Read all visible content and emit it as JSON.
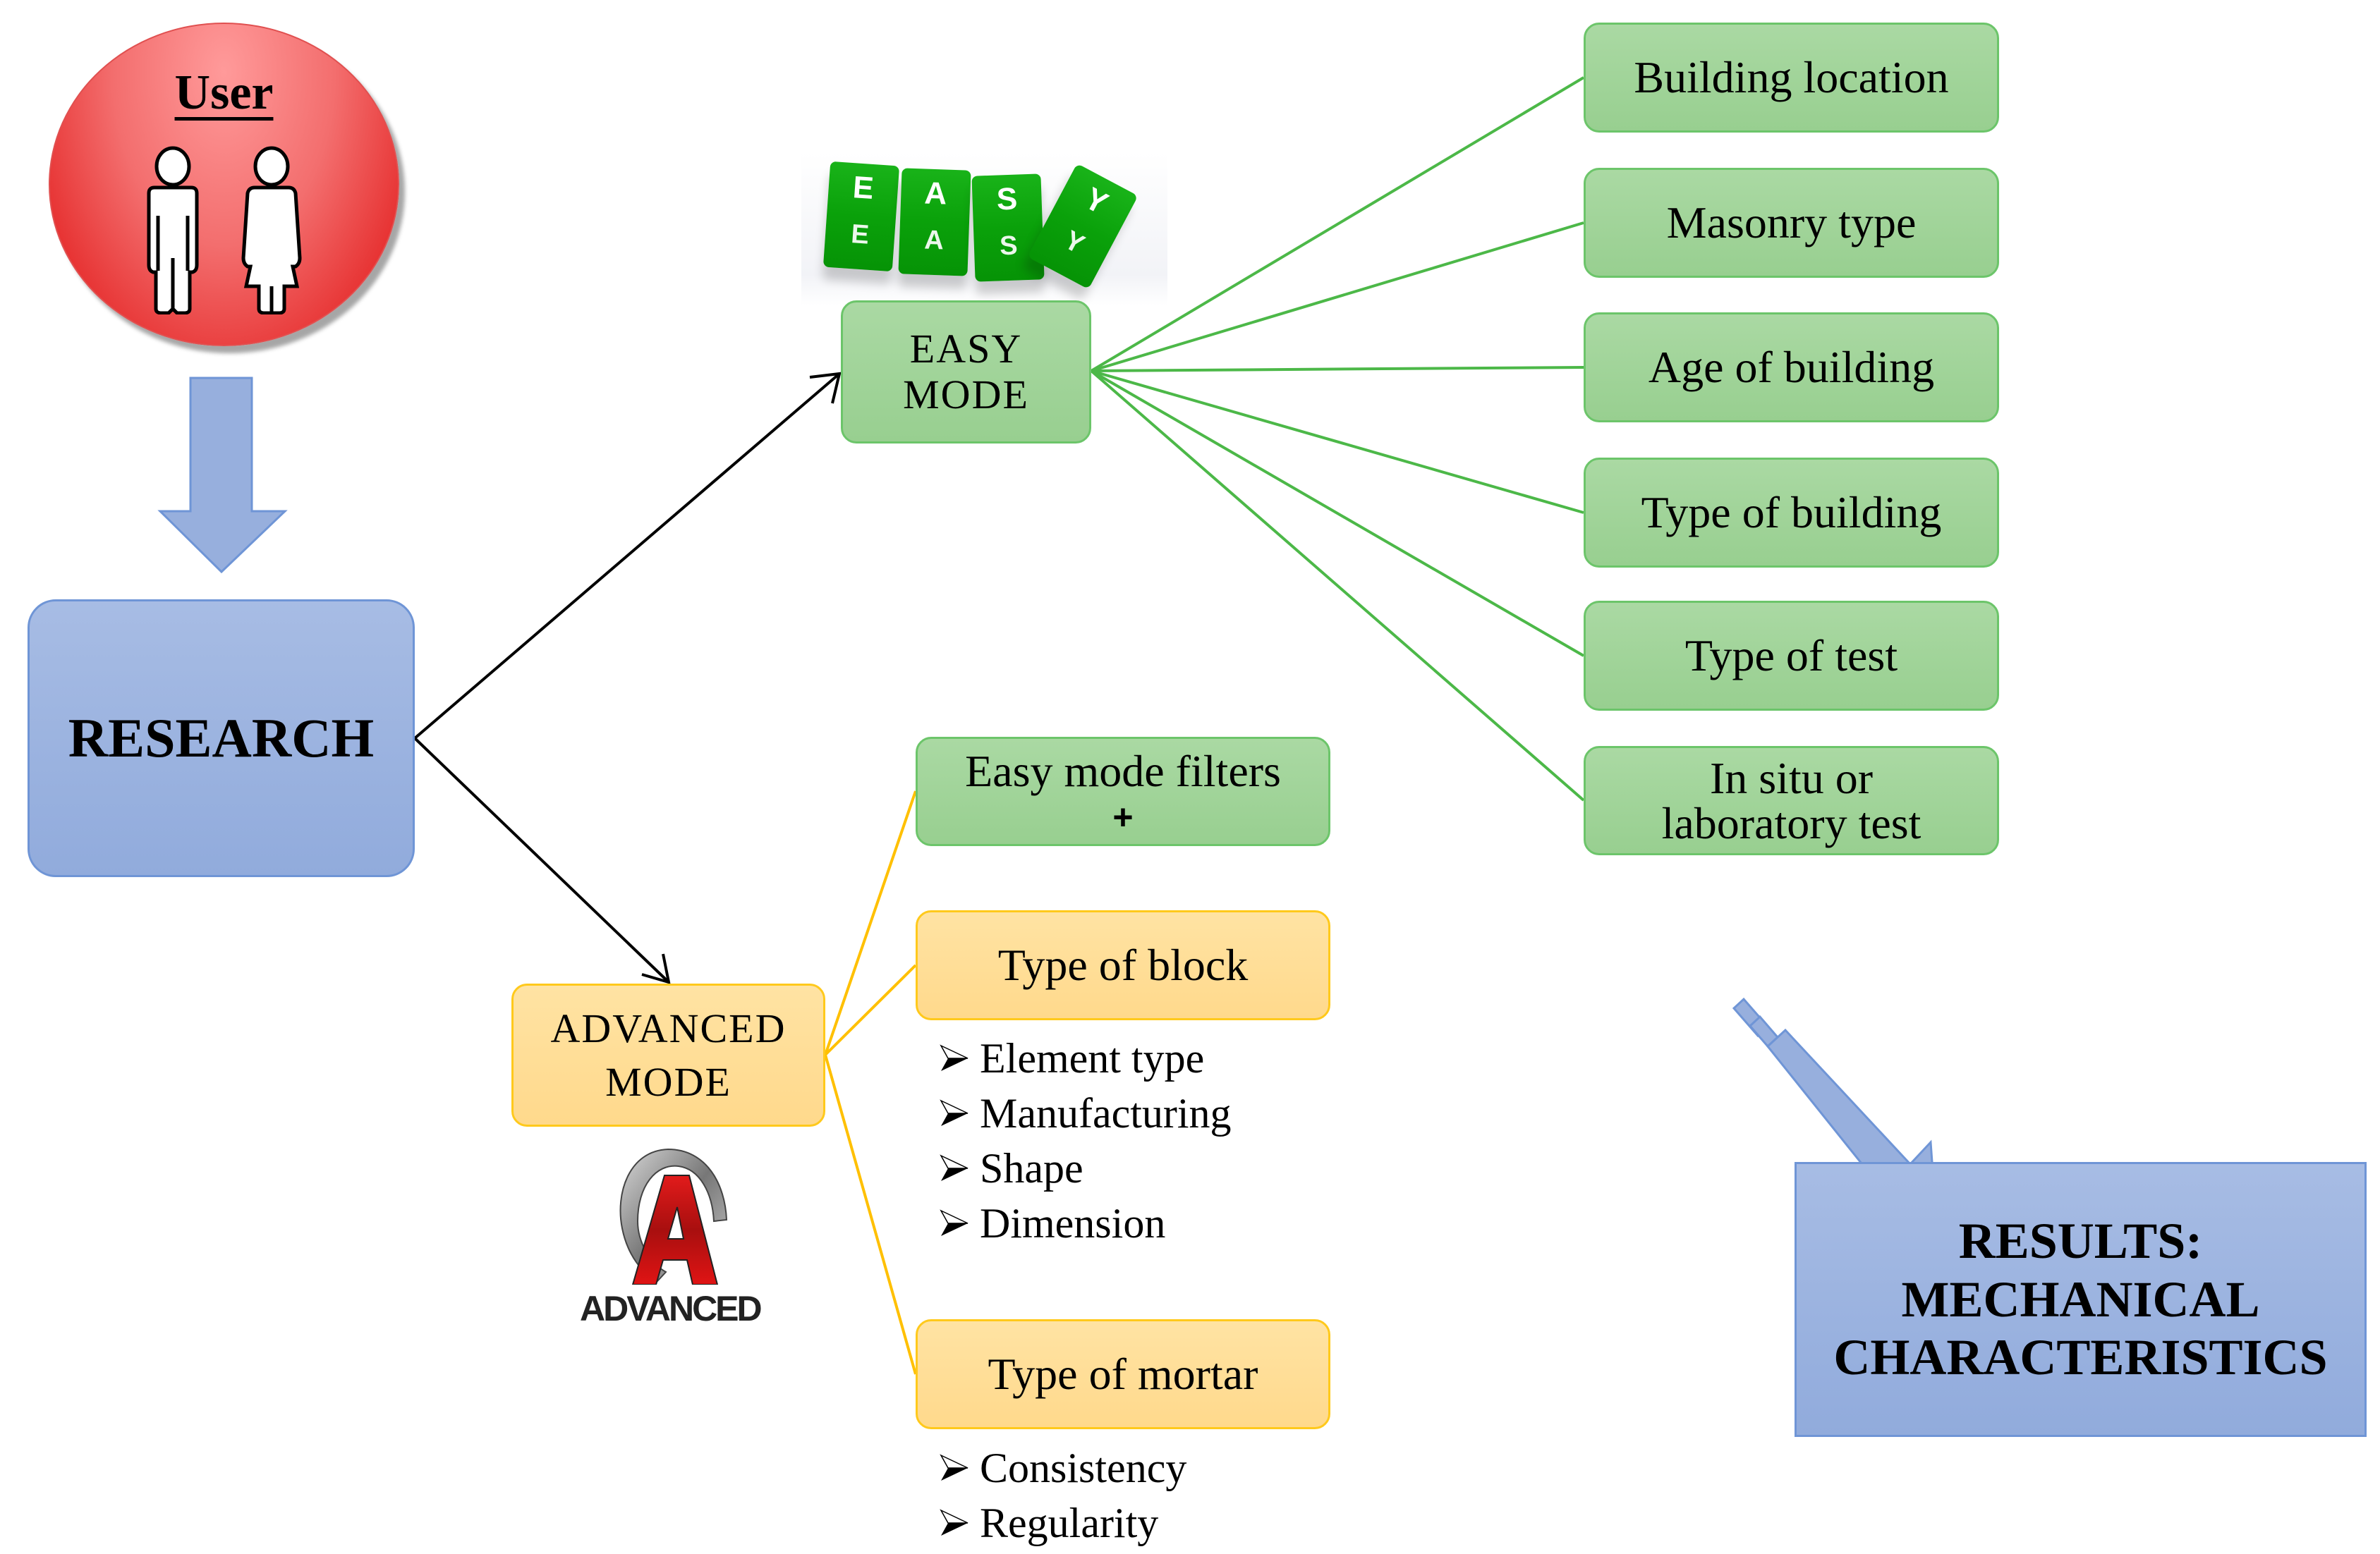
{
  "user": {
    "label": "User",
    "icons": [
      "man-icon",
      "woman-icon"
    ]
  },
  "research": {
    "label": "RESEARCH"
  },
  "easy_mode": {
    "label_line1": "EASY",
    "label_line2": "MODE",
    "cubes": [
      {
        "top": "E",
        "bottom": "E"
      },
      {
        "top": "A",
        "bottom": "A"
      },
      {
        "top": "S",
        "bottom": "S"
      },
      {
        "top": "Y",
        "bottom": "Y"
      }
    ],
    "filters": [
      {
        "lines": [
          "Building location"
        ]
      },
      {
        "lines": [
          "Masonry type"
        ]
      },
      {
        "lines": [
          "Age of building"
        ]
      },
      {
        "lines": [
          "Type of building"
        ]
      },
      {
        "lines": [
          "Type of test"
        ]
      },
      {
        "lines": [
          "In situ or",
          "laboratory test"
        ]
      }
    ]
  },
  "advanced_mode": {
    "label_line1": "ADVANCED",
    "label_line2": "MODE",
    "logo_letter": "A",
    "logo_text": "ADVANCED",
    "easy_filters_box": {
      "line1": "Easy mode filters",
      "line2": "+"
    },
    "type_of_block": {
      "label": "Type of block",
      "items": [
        "Element type",
        "Manufacturing",
        "Shape",
        "Dimension"
      ]
    },
    "type_of_mortar": {
      "label": "Type of mortar",
      "items": [
        "Consistency",
        "Regularity"
      ]
    }
  },
  "results": {
    "line1": "RESULTS:",
    "line2": "MECHANICAL",
    "line3": "CHARACTERISTICS"
  },
  "colors": {
    "research_blue": "#9bb3e0",
    "easy_green": "#a2d59a",
    "connector_green": "#4cb848",
    "advanced_yellow": "#ffdf99",
    "connector_yellow": "#ffc000",
    "user_red": "#e83030"
  }
}
